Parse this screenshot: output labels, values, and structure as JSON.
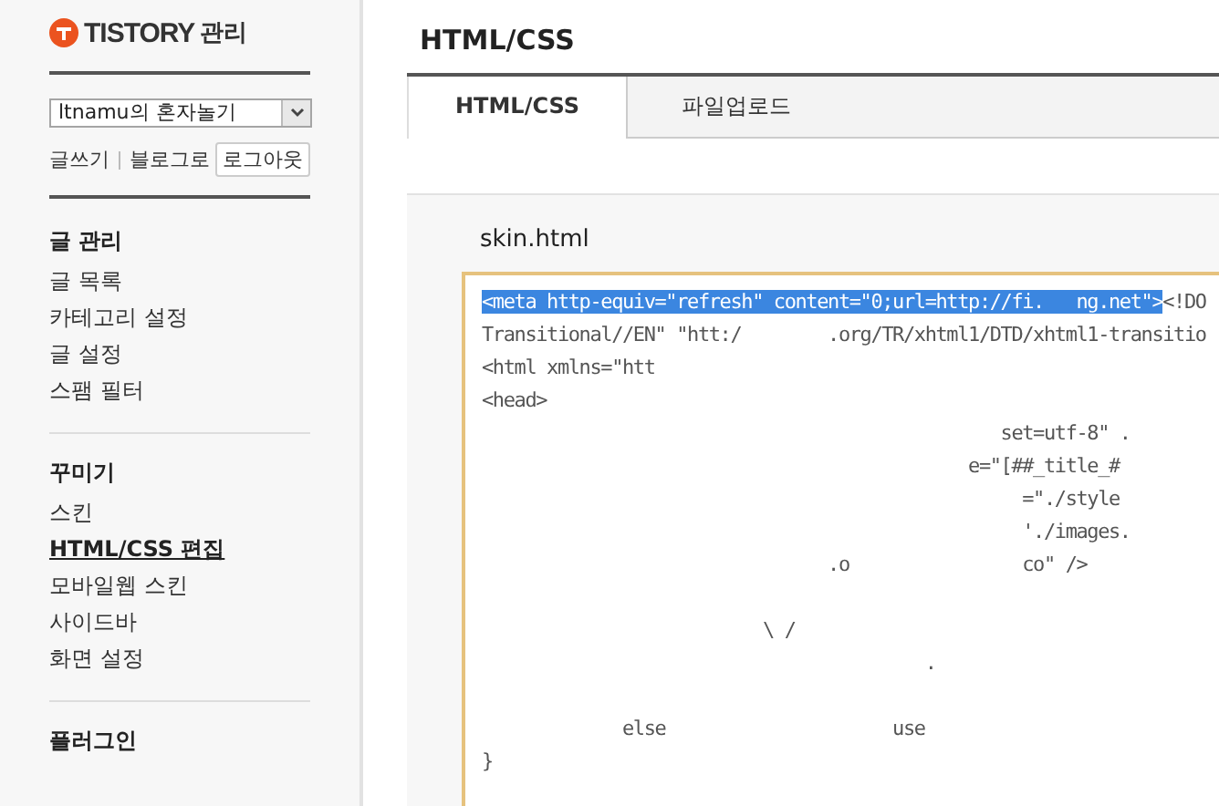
{
  "sidebar": {
    "logo": {
      "brand": "TISTORY",
      "suffix": "관리"
    },
    "blog_select": {
      "value": "ltnamu의 혼자놀기"
    },
    "links": [
      {
        "label": "글쓰기",
        "kind": "link"
      },
      {
        "label": "블로그로",
        "kind": "link"
      },
      {
        "label": "로그아웃",
        "kind": "button"
      }
    ],
    "sections": [
      {
        "title": "글 관리",
        "items": [
          {
            "label": "글 목록",
            "selected": false
          },
          {
            "label": "카테고리 설정",
            "selected": false
          },
          {
            "label": "글 설정",
            "selected": false
          },
          {
            "label": "스팸 필터",
            "selected": false
          }
        ]
      },
      {
        "title": "꾸미기",
        "items": [
          {
            "label": "스킨",
            "selected": false
          },
          {
            "label": "HTML/CSS 편집",
            "selected": true
          },
          {
            "label": "모바일웹 스킨",
            "selected": false
          },
          {
            "label": "사이드바",
            "selected": false
          },
          {
            "label": "화면 설정",
            "selected": false
          }
        ]
      },
      {
        "title": "플러그인"
      }
    ]
  },
  "page_title": "HTML/CSS",
  "tabs": [
    {
      "label": "HTML/CSS",
      "selected": true
    },
    {
      "label": "파일업로드",
      "selected": false
    }
  ],
  "editor": {
    "filename": "skin.html",
    "lines": [
      {
        "kind": "code",
        "segments": [
          {
            "text": "<meta http-equiv=\"refresh\" content=\"0;url=http://fi.   ng.net\">",
            "selected": true
          },
          {
            "text": "<!DO",
            "selected": false
          }
        ]
      },
      {
        "kind": "code",
        "segments": [
          {
            "text": "Transitional//EN\" \"htt:/        .org/TR/xhtml1/DTD/xhtml1-transitio",
            "selected": false
          }
        ]
      },
      {
        "kind": "code",
        "segments": [
          {
            "text": "<html xmlns=\"htt",
            "selected": false
          }
        ]
      },
      {
        "kind": "code",
        "segments": [
          {
            "text": "<head>",
            "selected": false
          }
        ]
      },
      {
        "kind": "code",
        "segments": [
          {
            "text": "                                                set=utf-8\" .",
            "selected": false
          }
        ]
      },
      {
        "kind": "code",
        "segments": [
          {
            "text": "                                             e=\"[##_title_#",
            "selected": false
          }
        ]
      },
      {
        "kind": "code",
        "segments": [
          {
            "text": "                                                  =\"./style",
            "selected": false
          }
        ]
      },
      {
        "kind": "code",
        "segments": [
          {
            "text": "                                                  './images.",
            "selected": false
          }
        ]
      },
      {
        "kind": "code",
        "segments": [
          {
            "text": "                                .o                co\" />",
            "selected": false
          }
        ]
      },
      {
        "kind": "blank"
      },
      {
        "kind": "code",
        "segments": [
          {
            "text": "                          \\ /",
            "selected": false
          }
        ]
      },
      {
        "kind": "code",
        "segments": [
          {
            "text": "                                         .",
            "selected": false
          }
        ]
      },
      {
        "kind": "blank"
      },
      {
        "kind": "code",
        "segments": [
          {
            "text": "             else                     use",
            "selected": false
          }
        ]
      },
      {
        "kind": "code",
        "segments": [
          {
            "text": "}",
            "selected": false
          }
        ]
      }
    ]
  }
}
